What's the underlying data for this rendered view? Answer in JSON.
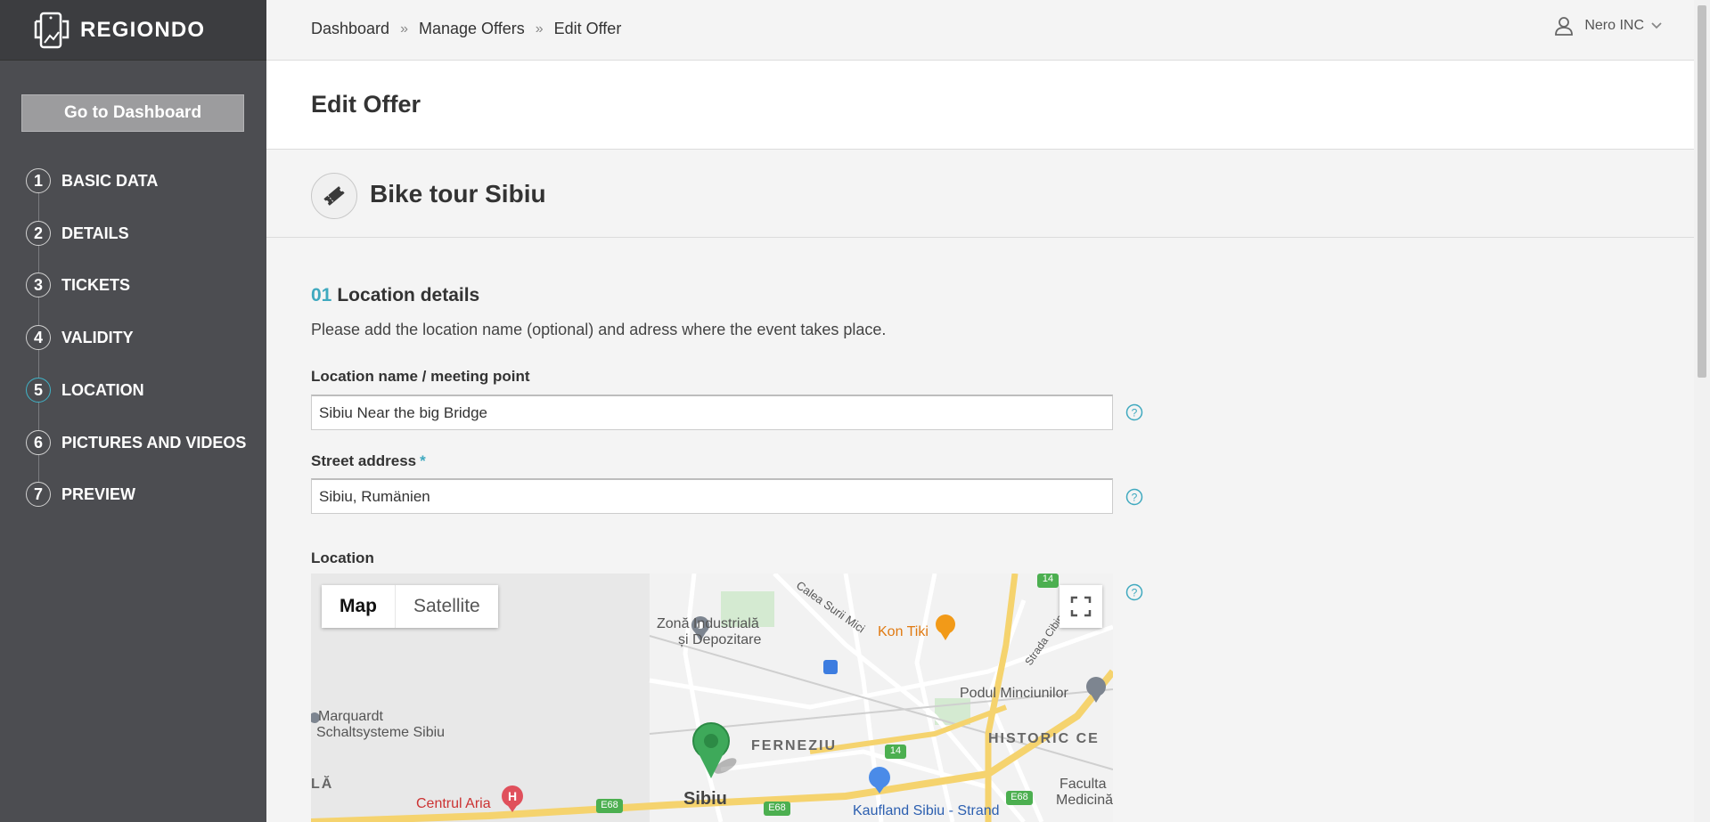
{
  "brand": {
    "name": "REGIONDO"
  },
  "sidebar": {
    "go_dashboard": "Go to Dashboard",
    "steps": [
      {
        "num": "1",
        "label": "BASIC DATA"
      },
      {
        "num": "2",
        "label": "DETAILS"
      },
      {
        "num": "3",
        "label": "TICKETS"
      },
      {
        "num": "4",
        "label": "VALIDITY"
      },
      {
        "num": "5",
        "label": "LOCATION"
      },
      {
        "num": "6",
        "label": "PICTURES AND VIDEOS"
      },
      {
        "num": "7",
        "label": "PREVIEW"
      }
    ],
    "active_step": 5
  },
  "breadcrumb": {
    "items": [
      "Dashboard",
      "Manage Offers",
      "Edit Offer"
    ],
    "separator": "»"
  },
  "user": {
    "name": "Nero INC"
  },
  "page": {
    "title": "Edit Offer",
    "offer_name": "Bike tour Sibiu"
  },
  "section": {
    "number": "01",
    "title": "Location details",
    "description": "Please add the location name (optional) and adress where the event takes place."
  },
  "form": {
    "location_name": {
      "label": "Location name / meeting point",
      "value": "Sibiu Near the big Bridge"
    },
    "street_address": {
      "label": "Street address",
      "required_mark": "*",
      "value": "Sibiu, Rumänien"
    },
    "location": {
      "label": "Location"
    }
  },
  "map": {
    "type_map": "Map",
    "type_satellite": "Satellite",
    "labels": {
      "zona1": "Zonă Industrială",
      "zona2": "și Depozitare",
      "calea": "Calea Surii Mici",
      "kontiki": "Kon Tiki",
      "strada": "Strada Cibinului",
      "podul": "Podul Minciunilor",
      "marquardt1": "Marquardt",
      "marquardt2": "Schaltsysteme Sibiu",
      "ferneziu": "FERNEZIU",
      "historic": "HISTORIC CE",
      "la": "LĂ",
      "centrul": "Centrul Aria",
      "sibiu": "Sibiu",
      "kaufland": "Kaufland Sibiu - Strand",
      "facultatea1": "Faculta",
      "facultatea2": "Medicină",
      "road_e68a": "E68",
      "road_e68b": "E68",
      "road_e68c": "E68",
      "road_14a": "14",
      "road_14b": "14"
    }
  },
  "colors": {
    "accent": "#3fa9bf",
    "sidebar_bg": "#4c4d51",
    "logo_bg": "#3c3d40"
  }
}
